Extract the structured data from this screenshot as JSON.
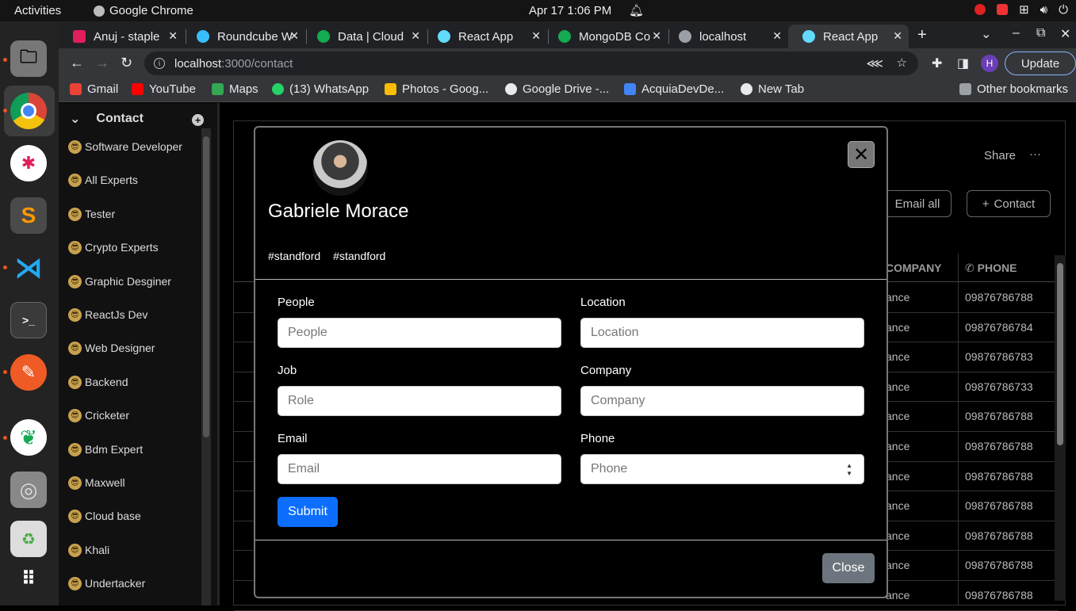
{
  "topbar": {
    "activities": "Activities",
    "app_name": "Google Chrome",
    "datetime": "Apr 17  1:06 PM"
  },
  "tabs": [
    {
      "title": "Anuj - staple",
      "color": "#e01e5a",
      "active": false
    },
    {
      "title": "Roundcube W",
      "color": "#37beff",
      "active": false
    },
    {
      "title": "Data | Cloud",
      "color": "#13aa52",
      "active": false
    },
    {
      "title": "React App",
      "color": "#61dafb",
      "active": false
    },
    {
      "title": "MongoDB Co",
      "color": "#13aa52",
      "active": false
    },
    {
      "title": "localhost",
      "color": "#9aa0a6",
      "active": false
    },
    {
      "title": "React App",
      "color": "#61dafb",
      "active": true
    }
  ],
  "omnibox": {
    "host": "localhost",
    "path": ":3000/contact"
  },
  "profile_initial": "H",
  "update_label": "Update",
  "bookmarks": [
    {
      "label": "Gmail",
      "color": "#ea4335"
    },
    {
      "label": "YouTube",
      "color": "#ff0000"
    },
    {
      "label": "Maps",
      "color": "#34a853"
    },
    {
      "label": "(13) WhatsApp",
      "color": "#25d366"
    },
    {
      "label": "Photos - Goog...",
      "color": "#fbbc04"
    },
    {
      "label": "Google Drive -...",
      "color": "#e8eaed"
    },
    {
      "label": "AcquiaDevDe...",
      "color": "#4285f4"
    },
    {
      "label": "New Tab",
      "color": "#e8eaed"
    }
  ],
  "other_bookmarks": "Other bookmarks",
  "sidebar": {
    "title": "Contact",
    "items": [
      "Software Developer",
      "All Experts",
      "Tester",
      "Crypto Experts",
      "Graphic Desginer",
      "ReactJs Dev",
      "Web Designer",
      "Backend",
      "Cricketer",
      "Bdm Expert",
      "Maxwell",
      "Cloud base",
      "Khali",
      "Undertacker"
    ]
  },
  "header": {
    "share": "Share",
    "more": "···",
    "email_all": "Email all",
    "add_contact": "Contact"
  },
  "table": {
    "company_header": "COMPANY",
    "phone_header": "PHONE",
    "rows": [
      {
        "company": "ance",
        "phone": "09876786788"
      },
      {
        "company": "ance",
        "phone": "09876786784"
      },
      {
        "company": "ance",
        "phone": "09876786783"
      },
      {
        "company": "ance",
        "phone": "09876786733"
      },
      {
        "company": "ance",
        "phone": "09876786788"
      },
      {
        "company": "ance",
        "phone": "09876786788"
      },
      {
        "company": "ance",
        "phone": "09876786788"
      },
      {
        "company": "ance",
        "phone": "09876786788"
      },
      {
        "company": "ance",
        "phone": "09876786788"
      },
      {
        "company": "ance",
        "phone": "09876786788"
      },
      {
        "company": "ance",
        "phone": "09876786788"
      }
    ]
  },
  "modal": {
    "name": "Gabriele Morace",
    "tags": [
      "#standford",
      "#standford"
    ],
    "fields": {
      "people": {
        "label": "People",
        "placeholder": "People"
      },
      "location": {
        "label": "Location",
        "placeholder": "Location"
      },
      "job": {
        "label": "Job",
        "placeholder": "Role"
      },
      "company": {
        "label": "Company",
        "placeholder": "Company"
      },
      "email": {
        "label": "Email",
        "placeholder": "Email"
      },
      "phone": {
        "label": "Phone",
        "placeholder": "Phone"
      }
    },
    "submit": "Submit",
    "close": "Close"
  }
}
